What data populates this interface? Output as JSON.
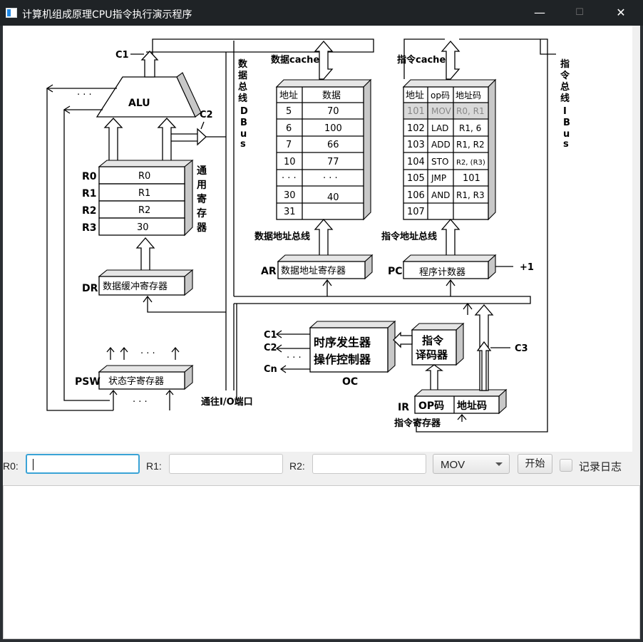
{
  "window": {
    "title": "计算机组成原理CPU指令执行演示程序",
    "minimize": "—",
    "maximize": "☐",
    "close": "✕"
  },
  "diagram": {
    "alu": "ALU",
    "c1_top": "C1",
    "c2": "C2",
    "dots_alu": "· · ·",
    "regs": {
      "r0": "R0",
      "r1": "R1",
      "r2": "R2",
      "r3": "R3",
      "r0v": "R0",
      "r1v": "R1",
      "r2v": "R2",
      "r3v": "30"
    },
    "gen_reg": [
      "通",
      "用",
      "寄",
      "存",
      "器"
    ],
    "dr": "DR",
    "dr_name": "数据缓冲寄存器",
    "psw": "PSW",
    "psw_name": "状态字寄存器",
    "psw_dots_top": "· · ·",
    "psw_dots_bottom": "· · ·",
    "io_port": "通往I/O端口",
    "dbus": [
      "数",
      "据",
      "总",
      "线",
      "D",
      "B",
      "u",
      "s"
    ],
    "data_cache": "数据cache",
    "data_table": {
      "headers": [
        "地址",
        "数据"
      ],
      "rows": [
        [
          "5",
          "70"
        ],
        [
          "6",
          "100"
        ],
        [
          "7",
          "66"
        ],
        [
          "10",
          "77"
        ],
        [
          "· · ·",
          "· · ·"
        ],
        [
          "30",
          "40"
        ],
        [
          "31",
          ""
        ]
      ]
    },
    "data_addr_bus": "数据地址总线",
    "ar": "AR",
    "ar_name": "数据地址寄存器",
    "instr_cache": "指令cache",
    "instr_table": {
      "headers": [
        "地址",
        "op码",
        "地址码"
      ],
      "rows": [
        [
          "101",
          "MOV",
          "R0, R1"
        ],
        [
          "102",
          "LAD",
          "R1, 6"
        ],
        [
          "103",
          "ADD",
          "R1, R2"
        ],
        [
          "104",
          "STO",
          "R2, (R3)"
        ],
        [
          "105",
          "JMP",
          "101"
        ],
        [
          "106",
          "AND",
          "R1, R3"
        ],
        [
          "107",
          "",
          ""
        ]
      ]
    },
    "instr_addr_bus": "指令地址总线",
    "pc": "PC",
    "pc_name": "程序计数器",
    "plus1": "+1",
    "ibus": [
      "指",
      "令",
      "总",
      "线",
      "I",
      "B",
      "u",
      "s"
    ],
    "timing_gen": "时序发生器",
    "op_ctrl": "操作控制器",
    "oc": "OC",
    "decoder1": "指令",
    "decoder2": "译码器",
    "c1": "C1",
    "c2b": "C2",
    "cn": "Cn",
    "dots_oc": "· · ·",
    "c3": "C3",
    "ir": "IR",
    "ir_op": "OP码",
    "ir_addr": "地址码",
    "ir_name": "指令寄存器"
  },
  "controls": {
    "r0_label": "R0:",
    "r0_value": "",
    "r1_label": "R1:",
    "r1_value": "",
    "r2_label": "R2:",
    "r2_value": "",
    "instruction": "MOV",
    "start": "开始",
    "log_checkbox": "记录日志",
    "log_checked": false
  },
  "log": {
    "text": ""
  }
}
